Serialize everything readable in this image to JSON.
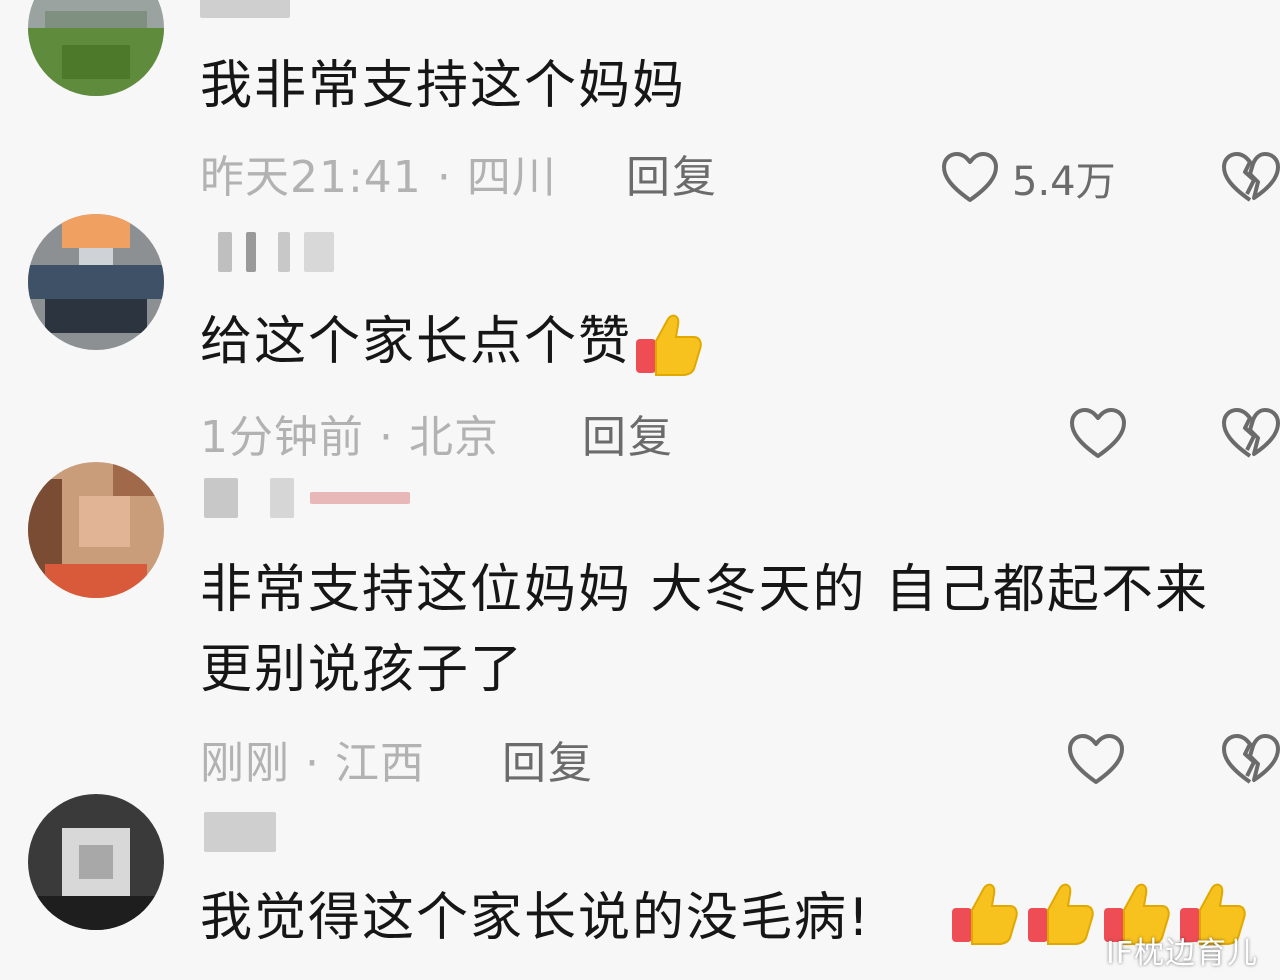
{
  "comments": [
    {
      "text": "我非常支持这个妈妈",
      "time": "昨天21:41",
      "location": "四川",
      "reply_label": "回复",
      "like_count": "5.4万"
    },
    {
      "text": "给这个家长点个赞",
      "time": "1分钟前",
      "location": "北京",
      "reply_label": "回复",
      "like_count": ""
    },
    {
      "text_line1": "非常支持这位妈妈 大冬天的 自己都起不来",
      "text_line2": "更别说孩子了",
      "time": "刚刚",
      "location": "江西",
      "reply_label": "回复",
      "like_count": ""
    },
    {
      "text": "我觉得这个家长说的没毛病!",
      "emoji_count": 4
    }
  ],
  "separator": "·",
  "icons": {
    "like": "heart-outline-icon",
    "dislike": "broken-heart-icon",
    "emoji": "thumbs-up-emoji"
  },
  "colors": {
    "meta_gray": "#b2b2b2",
    "reply_gray": "#6b6b6b",
    "thumb_yellow": "#f7c21d",
    "thumb_red": "#ee4d55"
  },
  "watermark": "IF枕边育儿"
}
